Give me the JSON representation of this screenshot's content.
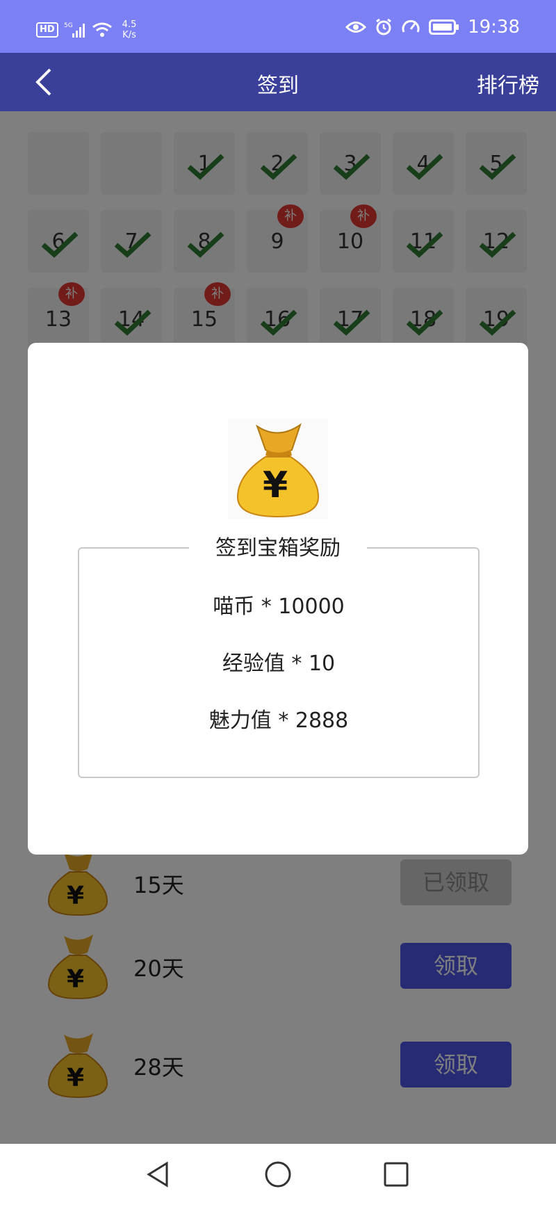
{
  "status_bar": {
    "hd": "HD",
    "signal": "5G",
    "net_speed_value": "4.5",
    "net_speed_unit": "K/s",
    "time": "19:38",
    "icons": [
      "eye-icon",
      "alarm-icon",
      "speedometer-icon",
      "battery-icon"
    ]
  },
  "app_bar": {
    "title": "签到",
    "right_action": "排行榜"
  },
  "calendar": {
    "days": [
      {
        "day": "",
        "state": "empty"
      },
      {
        "day": "",
        "state": "empty"
      },
      {
        "day": "1",
        "state": "checked"
      },
      {
        "day": "2",
        "state": "checked"
      },
      {
        "day": "3",
        "state": "checked"
      },
      {
        "day": "4",
        "state": "checked"
      },
      {
        "day": "5",
        "state": "checked"
      },
      {
        "day": "6",
        "state": "checked"
      },
      {
        "day": "7",
        "state": "checked"
      },
      {
        "day": "8",
        "state": "checked"
      },
      {
        "day": "9",
        "state": "missed",
        "badge": "补"
      },
      {
        "day": "10",
        "state": "missed",
        "badge": "补"
      },
      {
        "day": "11",
        "state": "checked"
      },
      {
        "day": "12",
        "state": "checked"
      },
      {
        "day": "13",
        "state": "missed",
        "badge": "补"
      },
      {
        "day": "14",
        "state": "checked"
      },
      {
        "day": "15",
        "state": "missed",
        "badge": "补"
      },
      {
        "day": "16",
        "state": "checked"
      },
      {
        "day": "17",
        "state": "checked"
      },
      {
        "day": "18",
        "state": "checked"
      },
      {
        "day": "19",
        "state": "checked"
      }
    ]
  },
  "reward_list": [
    {
      "days": "15天",
      "button": "已领取",
      "claimed": true
    },
    {
      "days": "20天",
      "button": "领取",
      "claimed": false
    },
    {
      "days": "28天",
      "button": "领取",
      "claimed": false
    }
  ],
  "dialog": {
    "title": "签到宝箱奖励",
    "rewards": [
      "喵币 * 10000",
      "经验值 * 10",
      "魅力值 * 2888"
    ]
  },
  "colors": {
    "status_bar": "#7b80f5",
    "app_bar": "#3a3f9a",
    "accent_button": "#4f56e8",
    "check": "#2e7d32",
    "badge": "#e53935"
  }
}
